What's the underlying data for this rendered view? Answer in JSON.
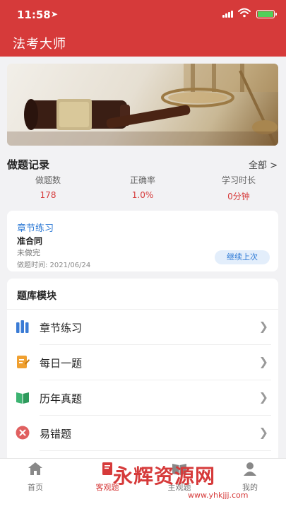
{
  "status_bar": {
    "time": "11:58"
  },
  "header": {
    "title": "法考大师"
  },
  "record": {
    "title": "做题记录",
    "see_all": "全部 >",
    "stats": [
      {
        "label": "做题数",
        "value": "178"
      },
      {
        "label": "正确率",
        "value": "1.0%"
      },
      {
        "label": "学习时长",
        "value": "0分钟"
      }
    ]
  },
  "last_practice": {
    "title": "章节练习",
    "subject": "准合同",
    "status": "未做完",
    "time": "做题时间: 2021/06/24",
    "button": "继续上次"
  },
  "modules": {
    "title": "题库模块",
    "items": [
      {
        "label": "章节练习",
        "icon": "bar-chart-icon",
        "color": "#3a7bd5"
      },
      {
        "label": "每日一题",
        "icon": "edit-doc-icon",
        "color": "#f0a030"
      },
      {
        "label": "历年真题",
        "icon": "book-icon",
        "color": "#3cb371"
      },
      {
        "label": "易错题",
        "icon": "close-circle-icon",
        "color": "#e06060"
      }
    ]
  },
  "tabbar": {
    "tabs": [
      {
        "label": "首页",
        "icon": "home-icon"
      },
      {
        "label": "客观题",
        "icon": "book-marked-icon"
      },
      {
        "label": "主观题",
        "icon": "open-book-icon"
      },
      {
        "label": "我的",
        "icon": "user-icon"
      }
    ],
    "active_index": 1
  },
  "watermark": {
    "text": "永辉资源网",
    "url": "www.yhkjjj.com"
  }
}
